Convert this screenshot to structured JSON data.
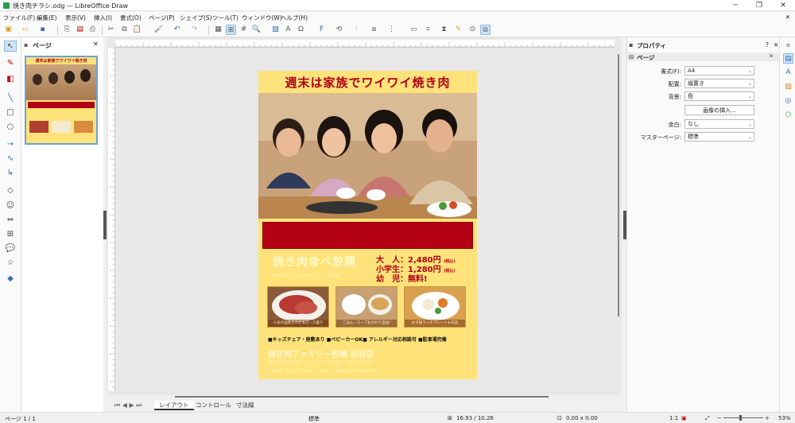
{
  "window": {
    "title": "焼き肉チラシ.odg — LibreOffice Draw"
  },
  "menu": [
    "ファイル(F)",
    "編集(E)",
    "表示(V)",
    "挿入(I)",
    "書式(O)",
    "ページ(P)",
    "シェイプ(S)",
    "ツール(T)",
    "ウィンドウ(W)",
    "ヘルプ(H)"
  ],
  "pages_panel": {
    "title": "ページ",
    "page_number": "1"
  },
  "poster": {
    "title": "週末は家族でワイワイ焼き肉",
    "plan": "焼き肉食べ放題",
    "plan_sub": "※90分制／ラストオーダー30分前",
    "price_adult": "大　人：2,480円",
    "price_child": "小学生：1,280円",
    "price_infant": "幼　児：無料!",
    "tax": "(税込)",
    "food_caps": [
      "人気の国産カルビ＆ロース盛り",
      "ごはん・スープおかわり自由!",
      "お子様ランチプレートも充実"
    ],
    "features": "■キッズチェア・座敷あり ■ベビーカーOK■ アレルギー対応相談可 ■駐車場完備",
    "shop_name": "焼き肉ファミリー牧場 渋谷店",
    "addr1": "東京都渋谷区道玄坂1-2-3 ファミリービル1階　渋谷駅／徒歩5分",
    "addr2": "営業時間：11:00〜23:00(L.O. 22:30)　電話番号：03-1234-5678"
  },
  "tabs": {
    "nav": "⏮ ◀ ▶ ⏭",
    "items": [
      "レイアウト",
      "コントロール",
      "寸法線"
    ]
  },
  "sidebar": {
    "title": "プロパティ",
    "section": "ページ",
    "format_label": "書式(F):",
    "format_value": "A4",
    "orient_label": "配置:",
    "orient_value": "縦置き",
    "bg_label": "背景:",
    "bg_value": "色",
    "insert_image": "画像の挿入...",
    "margin_label": "余白:",
    "margin_value": "なし",
    "master_label": "マスターページ:",
    "master_value": "標準"
  },
  "status": {
    "page": "ページ 1 / 1",
    "master": "標準",
    "position": "16.93 / 10.26",
    "size": "0.00 x 0.00",
    "scale": "1:1",
    "zoom": "53%"
  }
}
